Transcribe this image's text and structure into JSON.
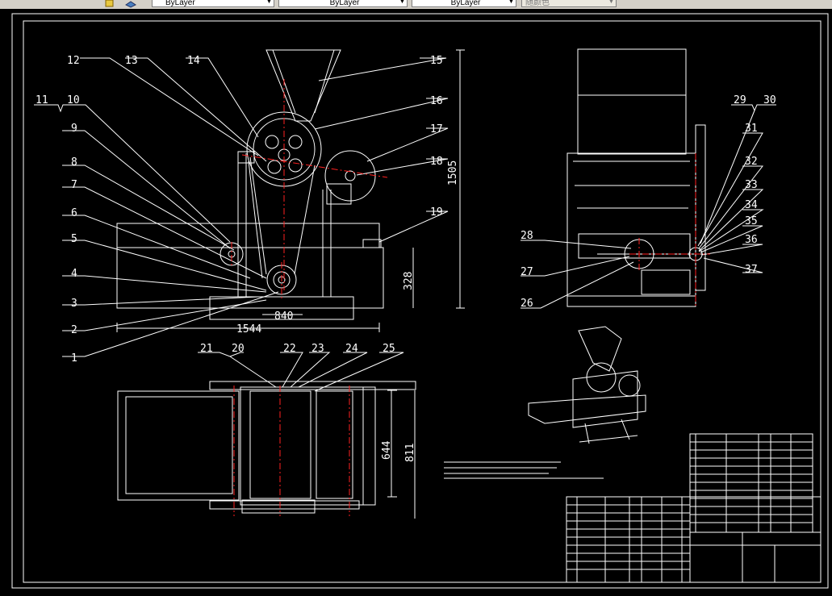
{
  "toolbar": {
    "layer_color": "ByLayer",
    "layer_linetype": "ByLayer",
    "layer_lineweight": "ByLayer",
    "plot_style": "随颜色"
  },
  "drawing": {
    "part_labels": [
      "1",
      "2",
      "3",
      "4",
      "5",
      "6",
      "7",
      "8",
      "9",
      "10",
      "11",
      "12",
      "13",
      "14",
      "15",
      "16",
      "17",
      "18",
      "19",
      "20",
      "21",
      "22",
      "23",
      "24",
      "25",
      "26",
      "27",
      "28",
      "29",
      "30",
      "31",
      "32",
      "33",
      "34",
      "35",
      "36",
      "37"
    ],
    "dimensions": {
      "total_height": "1505",
      "base_height": "328",
      "base_width": "840",
      "total_length": "1544",
      "plan_depth_inner": "644",
      "plan_depth_outer": "811"
    }
  },
  "colors": {
    "background": "#000000",
    "line": "#ffffff",
    "centerline": "#ff2020",
    "toolbar": "#d4d0c8"
  }
}
